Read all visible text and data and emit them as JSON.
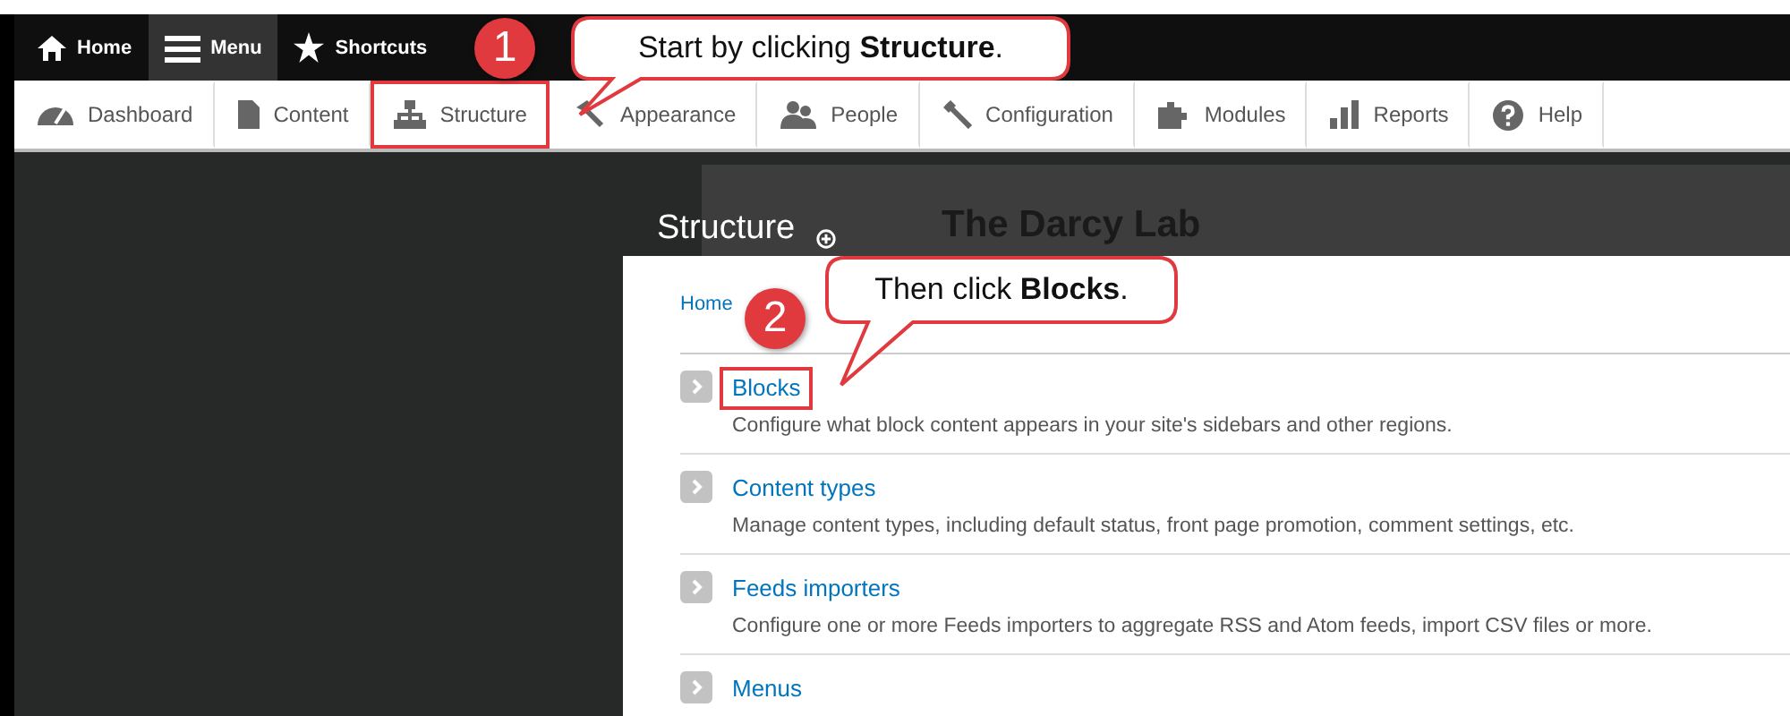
{
  "toolbar": {
    "items": [
      {
        "label": "Home",
        "selected": false
      },
      {
        "label": "Menu",
        "selected": true
      },
      {
        "label": "Shortcuts",
        "selected": false
      }
    ]
  },
  "admin_menu": {
    "items": [
      {
        "label": "Dashboard",
        "highlighted": false
      },
      {
        "label": "Content",
        "highlighted": false
      },
      {
        "label": "Structure",
        "highlighted": true
      },
      {
        "label": "Appearance",
        "highlighted": false
      },
      {
        "label": "People",
        "highlighted": false
      },
      {
        "label": "Configuration",
        "highlighted": false
      },
      {
        "label": "Modules",
        "highlighted": false
      },
      {
        "label": "Reports",
        "highlighted": false
      },
      {
        "label": "Help",
        "highlighted": false
      }
    ]
  },
  "page": {
    "site_name": "The Darcy Lab",
    "title": "Structure",
    "breadcrumb": [
      "Home"
    ],
    "items": [
      {
        "title": "Blocks",
        "description": "Configure what block content appears in your site's sidebars and other regions.",
        "highlighted": true
      },
      {
        "title": "Content types",
        "description": "Manage content types, including default status, front page promotion, comment settings, etc.",
        "highlighted": false
      },
      {
        "title": "Feeds importers",
        "description": "Configure one or more Feeds importers to aggregate RSS and Atom feeds, import CSV files or more.",
        "highlighted": false
      },
      {
        "title": "Menus",
        "highlighted": false
      }
    ]
  },
  "callouts": [
    {
      "number": "1",
      "text": "Start by clicking **Structure**."
    },
    {
      "number": "2",
      "text": "Then click **Blocks**."
    }
  ]
}
